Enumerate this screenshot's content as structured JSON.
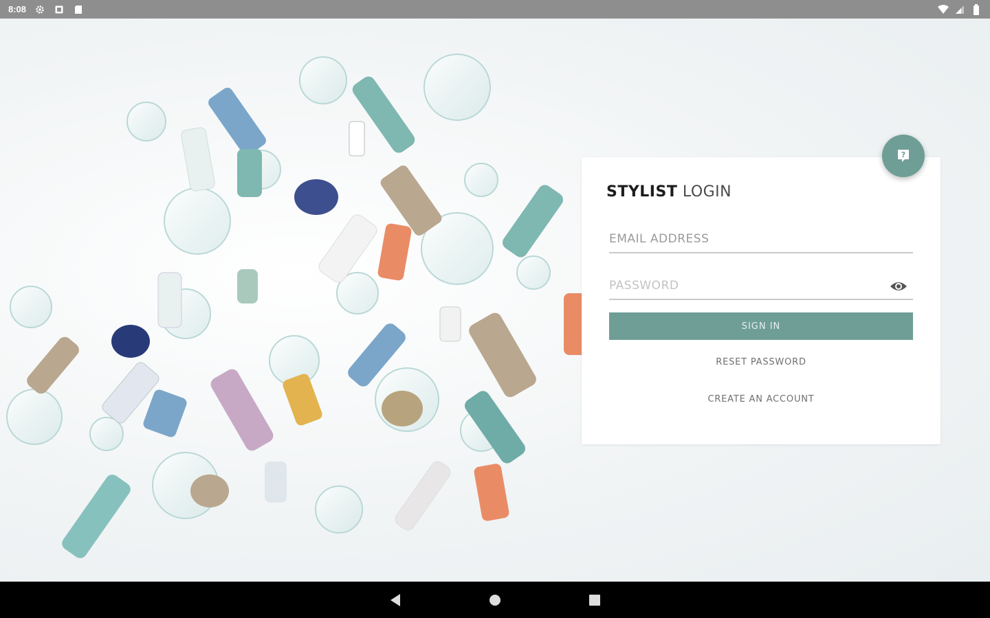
{
  "status_bar": {
    "time": "8:08",
    "icons": [
      "gear-icon",
      "sim-icon",
      "sd-card-icon"
    ],
    "right_icons": [
      "wifi-icon",
      "signal-icon",
      "battery-icon"
    ]
  },
  "background": {
    "description_icon": "product-scene-image"
  },
  "login": {
    "title_bold": "STYLIST",
    "title_light": "LOGIN",
    "email_placeholder": "EMAIL ADDRESS",
    "email_value": "",
    "password_placeholder": "PASSWORD",
    "password_value": "",
    "signin_label": "SIGN IN",
    "reset_label": "RESET PASSWORD",
    "create_label": "CREATE AN ACCOUNT",
    "help_icon": "help-icon",
    "visibility_icon": "eye-icon"
  },
  "nav_bar": {
    "buttons": [
      "back-icon",
      "home-icon",
      "recents-icon"
    ]
  },
  "colors": {
    "accent": "#6f9e96",
    "status_bar": "#8e8e8e",
    "nav_bar": "#000000"
  }
}
